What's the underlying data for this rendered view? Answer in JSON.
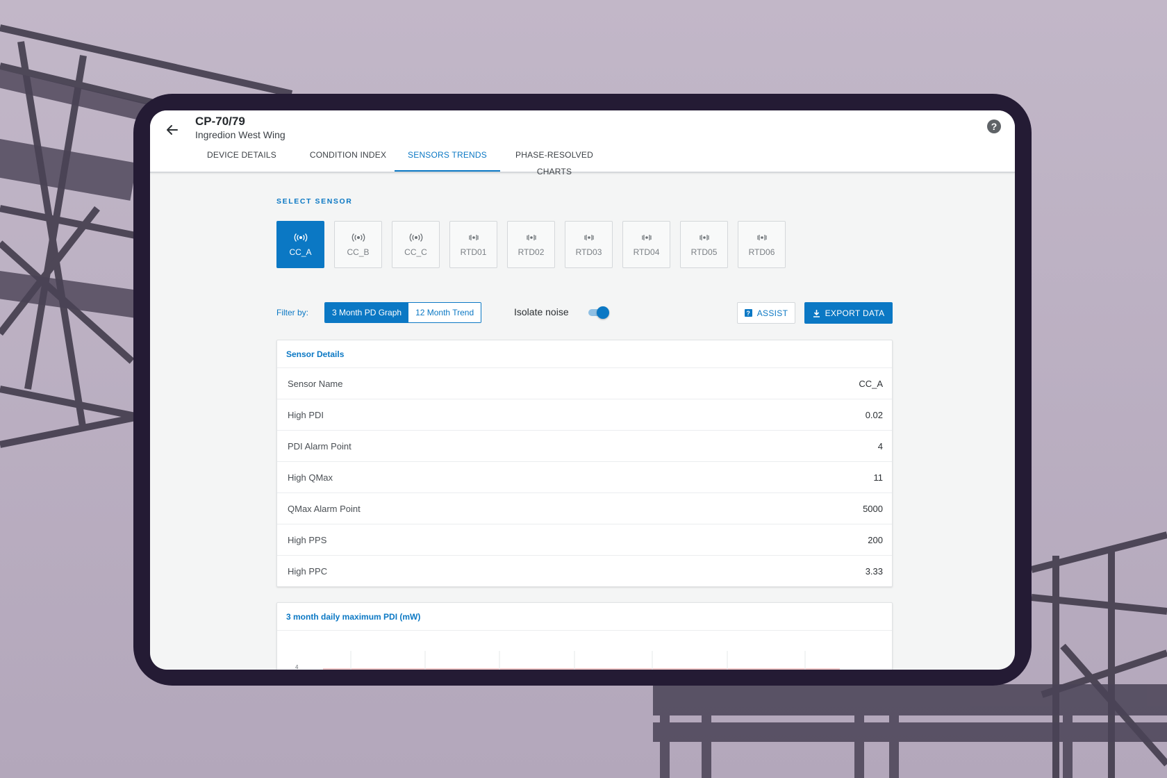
{
  "header": {
    "title": "CP-70/79",
    "subtitle": "Ingredion West Wing"
  },
  "tabs": [
    {
      "label": "DEVICE DETAILS",
      "active": false
    },
    {
      "label": "CONDITION INDEX",
      "active": false
    },
    {
      "label": "SENSORS TRENDS",
      "active": true
    },
    {
      "label": "PHASE-RESOLVED CHARTS",
      "active": false
    }
  ],
  "select_sensor_label": "SELECT SENSOR",
  "sensors": [
    {
      "label": "CC_A",
      "icon": "signal-icon",
      "active": true
    },
    {
      "label": "CC_B",
      "icon": "signal-icon",
      "active": false
    },
    {
      "label": "CC_C",
      "icon": "signal-icon",
      "active": false
    },
    {
      "label": "RTD01",
      "icon": "rtd-signal-icon",
      "active": false
    },
    {
      "label": "RTD02",
      "icon": "rtd-signal-icon",
      "active": false
    },
    {
      "label": "RTD03",
      "icon": "rtd-signal-icon",
      "active": false
    },
    {
      "label": "RTD04",
      "icon": "rtd-signal-icon",
      "active": false
    },
    {
      "label": "RTD05",
      "icon": "rtd-signal-icon",
      "active": false
    },
    {
      "label": "RTD06",
      "icon": "rtd-signal-icon",
      "active": false
    }
  ],
  "filter": {
    "label": "Filter by:",
    "options": [
      {
        "label": "3 Month PD Graph",
        "active": true
      },
      {
        "label": "12 Month Trend",
        "active": false
      }
    ]
  },
  "isolate_noise": {
    "label": "Isolate noise",
    "enabled": true
  },
  "actions": {
    "assist_label": "ASSIST",
    "export_label": "EXPORT DATA"
  },
  "sensor_details": {
    "title": "Sensor Details",
    "rows": [
      {
        "key": "Sensor Name",
        "value": "CC_A"
      },
      {
        "key": "High PDI",
        "value": "0.02"
      },
      {
        "key": "PDI Alarm Point",
        "value": "4"
      },
      {
        "key": "High QMax",
        "value": "11"
      },
      {
        "key": "QMax Alarm Point",
        "value": "5000"
      },
      {
        "key": "High PPS",
        "value": "200"
      },
      {
        "key": "High PPC",
        "value": "3.33"
      }
    ]
  },
  "chart": {
    "title": "3 month daily maximum PDI (mW)",
    "y_tick_top": "4"
  },
  "colors": {
    "accent": "#0b78c4",
    "frame": "#241b34",
    "background": "#b9adc0"
  }
}
